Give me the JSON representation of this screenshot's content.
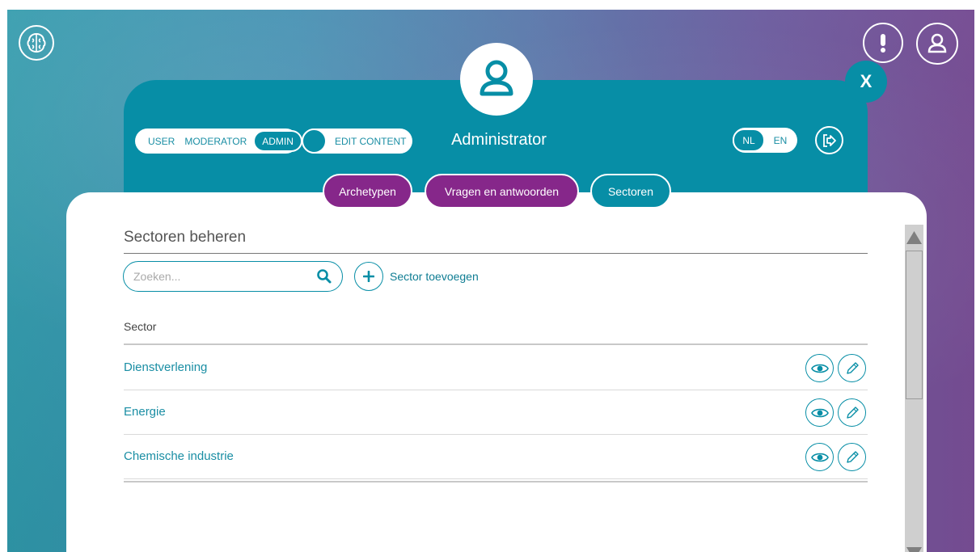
{
  "header": {
    "role_title": "Administrator",
    "close_label": "X",
    "roles": {
      "user": "USER",
      "moderator": "MODERATOR",
      "admin": "ADMIN"
    },
    "edit_content_label": "EDIT CONTENT",
    "languages": {
      "active": "NL",
      "other": "EN"
    }
  },
  "tabs": [
    {
      "label": "Archetypen"
    },
    {
      "label": "Vragen en antwoorden"
    },
    {
      "label": "Sectoren"
    }
  ],
  "main": {
    "title": "Sectoren beheren",
    "search_placeholder": "Zoeken...",
    "add_label": "Sector toevoegen",
    "column_header": "Sector",
    "rows": [
      {
        "name": "Dienstverlening"
      },
      {
        "name": "Energie"
      },
      {
        "name": "Chemische industrie"
      }
    ]
  },
  "colors": {
    "teal": "#078ea6",
    "purple": "#86278a",
    "background_start": "#2f99ab",
    "background_end": "#7a4f98"
  },
  "icons": [
    "brain-icon",
    "alert-icon",
    "user-icon",
    "logout-icon",
    "search-icon",
    "plus-icon",
    "eye-icon",
    "pencil-icon"
  ]
}
